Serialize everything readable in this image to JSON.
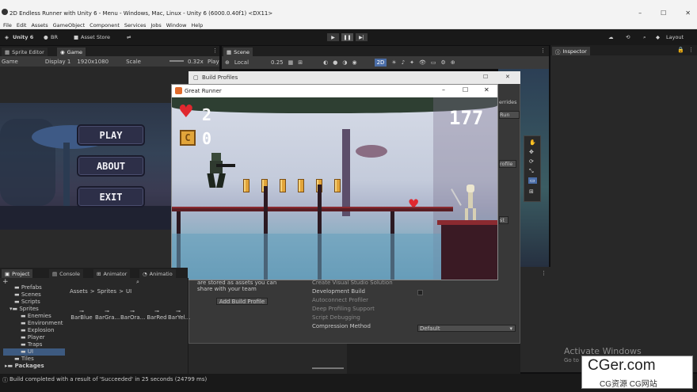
{
  "window": {
    "title": "2D Endless Runner with Unity 6 - Menu - Windows, Mac, Linux - Unity 6 (6000.0.40f1) <DX11>",
    "minimize": "–",
    "maximize": "☐",
    "close": "✕"
  },
  "menu": [
    "File",
    "Edit",
    "Assets",
    "GameObject",
    "Component",
    "Services",
    "Jobs",
    "Window",
    "Help"
  ],
  "toolbar": {
    "unity_label": "Unity 6",
    "account_label": "BR",
    "asset_store_label": "Asset Store",
    "layout_label": "Layout"
  },
  "left_tabs": {
    "sprite_editor": "Sprite Editor",
    "game": "Game"
  },
  "game_bar": {
    "mode": "Game",
    "display": "Display 1",
    "resolution": "1920x1080",
    "scale_label": "Scale",
    "scale_value": "0.32x",
    "play_label": "Play"
  },
  "scene_tab": {
    "label": "Scene"
  },
  "scene_bar": {
    "pivot": "Local",
    "snap_value": "0.25",
    "mode_2d": "2D"
  },
  "inspector_tab": {
    "label": "Inspector"
  },
  "main_menu": {
    "play": "PLAY",
    "about": "ABOUT",
    "exit": "EXIT"
  },
  "build_profiles": {
    "title": "Build Profiles",
    "text_line1": "are stored as assets you can",
    "text_line2": "share with your team",
    "add_button": "Add Build Profile",
    "options": [
      "Create Visual Studio Solution",
      "Development Build",
      "Autoconnect Profiler",
      "Deep Profiling Support",
      "Script Debugging"
    ],
    "compression_label": "Compression Method",
    "compression_value": "Default",
    "side_overrides": "errides",
    "side_run": "Run",
    "side_profile": "rofile",
    "side_list": "st"
  },
  "great_runner": {
    "title": "Great Runner",
    "lives": "2",
    "coins": "0",
    "score": "177",
    "coin_badge": "C"
  },
  "bottom_tabs": {
    "project": "Project",
    "console": "Console",
    "animator": "Animator",
    "animation": "Animatio"
  },
  "project_tree": [
    "Prefabs",
    "Scenes",
    "Scripts",
    "Sprites",
    "Enemies",
    "Environment",
    "Explosion",
    "Player",
    "Traps",
    "UI",
    "Tiles",
    "Packages"
  ],
  "breadcrumb": {
    "assets": "Assets",
    "sprites": "Sprites",
    "ui": "UI",
    "sep": ">"
  },
  "sprite_names": [
    "BarBlue",
    "BarGra...",
    "BarOra...",
    "BarRed",
    "BarYel..."
  ],
  "status": {
    "message": "Build completed with a result of 'Succeeded' in 25 seconds (24799 ms)"
  },
  "watermark": {
    "activate_title": "Activate Windows",
    "activate_sub": "Go to",
    "site": "CGer.com",
    "site_cn": "CG资源 CG网站"
  },
  "colors": {
    "unity_dark": "#191919",
    "panel": "#282828",
    "menu_button": "#2d2f48",
    "heart": "#e0282f",
    "coin": "#e2a53a"
  }
}
